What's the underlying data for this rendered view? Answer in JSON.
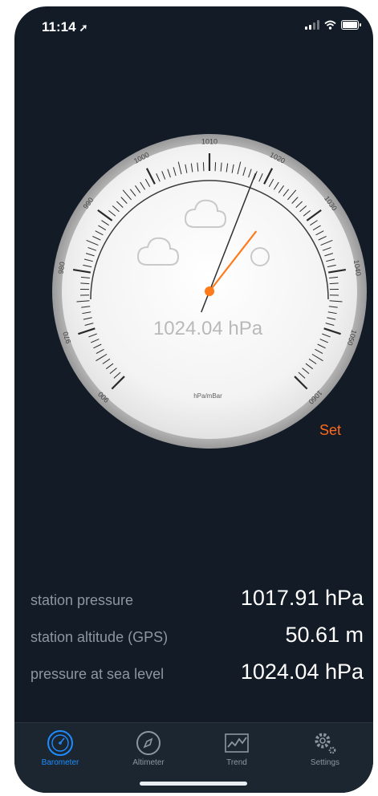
{
  "status_bar": {
    "time": "11:14",
    "location_arrow": "➚"
  },
  "gauge": {
    "ticks": [
      {
        "label": "900",
        "value": 900
      },
      {
        "label": "970",
        "value": 970
      },
      {
        "label": "980",
        "value": 980
      },
      {
        "label": "990",
        "value": 990
      },
      {
        "label": "1000",
        "value": 1000
      },
      {
        "label": "1010",
        "value": 1010
      },
      {
        "label": "1020",
        "value": 1020
      },
      {
        "label": "1030",
        "value": 1030
      },
      {
        "label": "1040",
        "value": 1040
      },
      {
        "label": "1050",
        "value": 1050
      },
      {
        "label": "1060",
        "value": 1060
      }
    ],
    "pressure_needle_value": 1024.04,
    "reference_needle_value": 1017.91,
    "readout": "1024.04 hPa",
    "unit": "hPa/mBar",
    "needle_color": "#ff7a1a"
  },
  "set_label": "Set",
  "readings": [
    {
      "label": "station pressure",
      "value": "1017.91 hPa"
    },
    {
      "label": "station altitude (GPS)",
      "value": "50.61 m"
    },
    {
      "label": "pressure at sea level",
      "value": "1024.04 hPa"
    }
  ],
  "tabs": [
    {
      "label": "Barometer",
      "icon": "barometer-icon",
      "active": true
    },
    {
      "label": "Altimeter",
      "icon": "compass-icon",
      "active": false
    },
    {
      "label": "Trend",
      "icon": "trend-icon",
      "active": false
    },
    {
      "label": "Settings",
      "icon": "settings-icon",
      "active": false
    }
  ],
  "colors": {
    "background": "#121b26",
    "accent": "#1e8cff",
    "set": "#ff6a1a"
  }
}
